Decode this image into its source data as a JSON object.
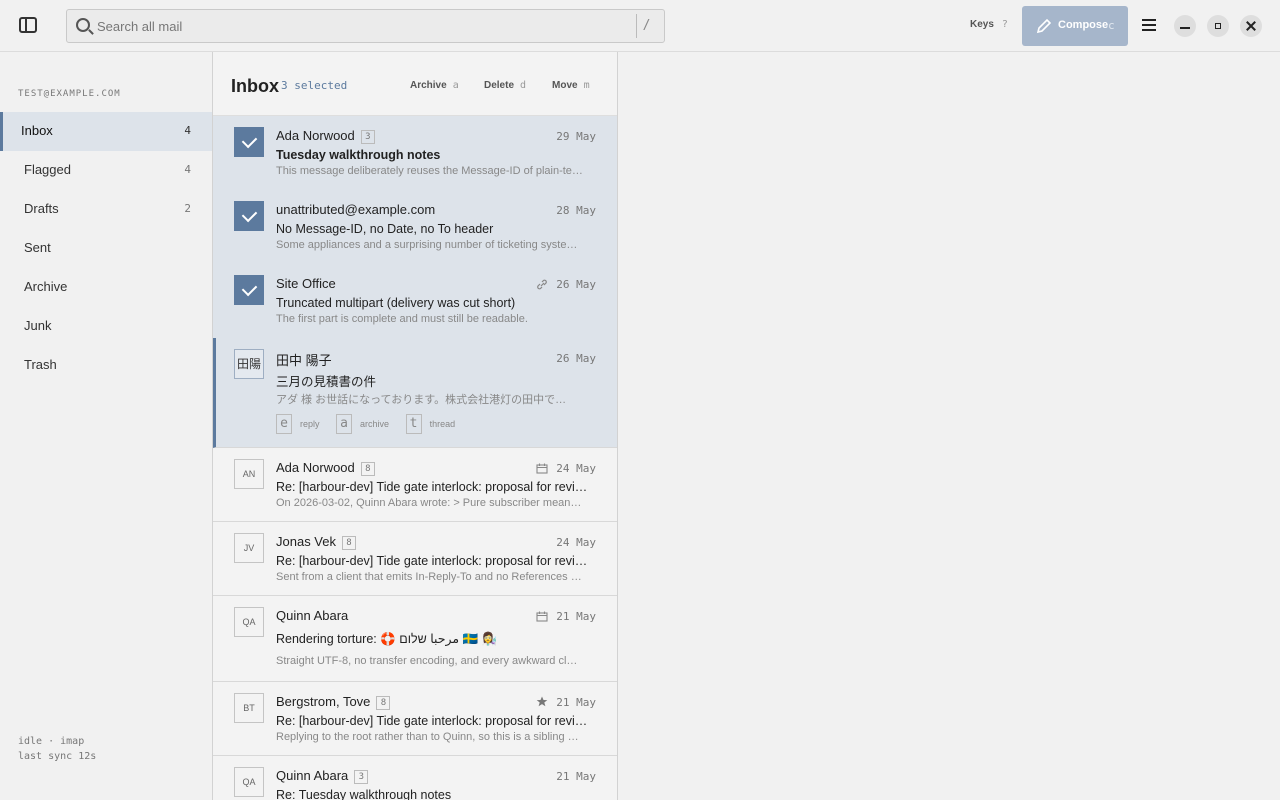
{
  "topbar": {
    "search_placeholder": "Search all mail",
    "search_kbd": "/",
    "keys_label": "Keys",
    "keys_hint": "?",
    "compose_label": "Compose",
    "compose_hint": "c"
  },
  "sidebar": {
    "account": "TEST@EXAMPLE.COM",
    "folders": [
      {
        "name": "Inbox",
        "count": "4"
      },
      {
        "name": "Flagged",
        "count": "4"
      },
      {
        "name": "Drafts",
        "count": "2"
      },
      {
        "name": "Sent",
        "count": ""
      },
      {
        "name": "Archive",
        "count": ""
      },
      {
        "name": "Junk",
        "count": ""
      },
      {
        "name": "Trash",
        "count": ""
      }
    ],
    "status_line1": "idle · imap",
    "status_line2": "last sync 12s"
  },
  "list": {
    "title": "Inbox",
    "selected": "3 selected",
    "actions": [
      {
        "label": "Archive",
        "hint": "a"
      },
      {
        "label": "Delete",
        "hint": "d"
      },
      {
        "label": "Move",
        "hint": "m"
      }
    ],
    "rows": [
      {
        "sender": "Ada Norwood",
        "count": "3",
        "date": "29 May",
        "subject": "Tuesday walkthrough notes",
        "snippet": "This message deliberately reuses the Message-ID of plain-te…",
        "initials": ""
      },
      {
        "sender": "unattributed@example.com",
        "count": "",
        "date": "28 May",
        "subject": "No Message-ID, no Date, no To header",
        "snippet": "Some appliances and a surprising number of ticketing syste…",
        "initials": ""
      },
      {
        "sender": "Site Office",
        "count": "",
        "date": "26 May",
        "subject": "Truncated multipart (delivery was cut short)",
        "snippet": "The first part is complete and must still be readable.",
        "initials": ""
      },
      {
        "sender": "田中 陽子",
        "count": "",
        "date": "26 May",
        "subject": "三月の見積書の件",
        "snippet": "アダ 様 お世話になっております。株式会社港灯の田中で…",
        "initials": "田陽"
      },
      {
        "sender": "Ada Norwood",
        "count": "8",
        "date": "24 May",
        "subject": "Re: [harbour-dev] Tide gate interlock: proposal for revi…",
        "snippet": "On 2026-03-02, Quinn Abara wrote: > Pure subscriber mean…",
        "initials": "AN"
      },
      {
        "sender": "Jonas Vek",
        "count": "8",
        "date": "24 May",
        "subject": "Re: [harbour-dev] Tide gate interlock: proposal for revi…",
        "snippet": "Sent from a client that emits In-Reply-To and no References …",
        "initials": "JV"
      },
      {
        "sender": "Quinn Abara",
        "count": "",
        "date": "21 May",
        "subject": "Rendering torture: 🛟 مرحبا שלום 🇸🇪 👩‍🔬",
        "snippet": "Straight UTF-8, no transfer encoding, and every awkward cl…",
        "initials": "QA"
      },
      {
        "sender": "Bergstrom, Tove",
        "count": "8",
        "date": "21 May",
        "subject": "Re: [harbour-dev] Tide gate interlock: proposal for revi…",
        "snippet": "Replying to the root rather than to Quinn, so this is a sibling …",
        "initials": "BT"
      },
      {
        "sender": "Quinn Abara",
        "count": "3",
        "date": "21 May",
        "subject": "Re: Tuesday walkthrough notes",
        "snippet": "",
        "initials": "QA"
      }
    ],
    "row_hints": [
      {
        "key": "e",
        "label": "reply"
      },
      {
        "key": "a",
        "label": "archive"
      },
      {
        "key": "t",
        "label": "thread"
      }
    ]
  },
  "colors": {
    "accent": "#5c7a9e",
    "compose": "#a6b6cb",
    "selection": "#dde3ea"
  }
}
